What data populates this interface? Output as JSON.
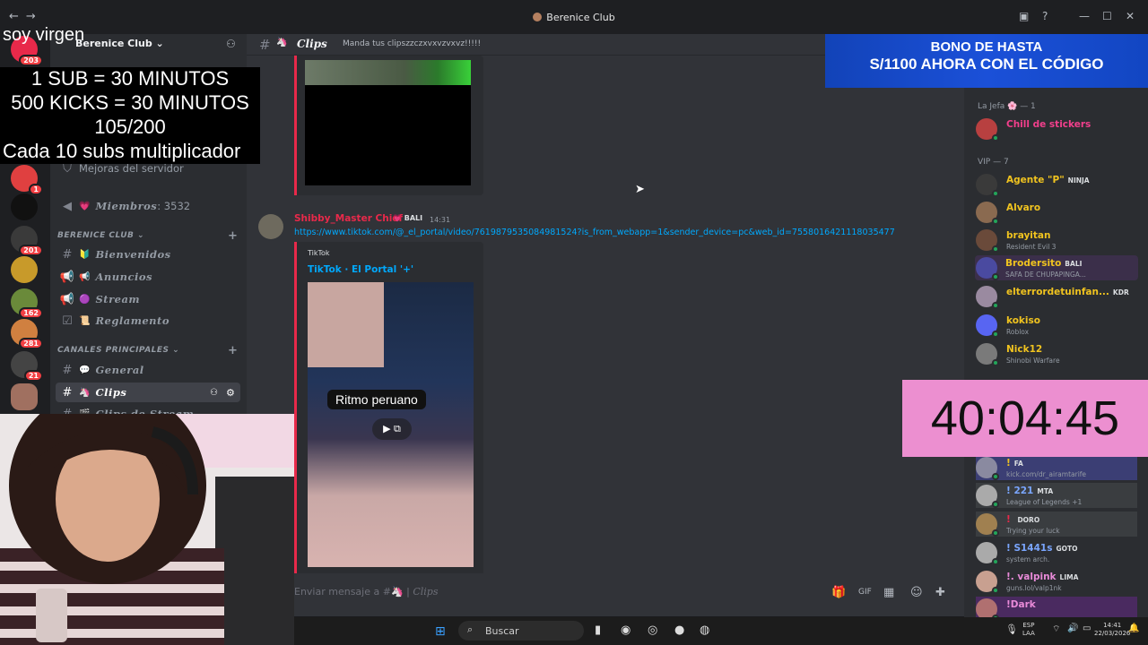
{
  "window": {
    "title": "Berenice Club"
  },
  "overlay": {
    "virgen": "soy virgen",
    "line1": "1 SUB     = 30 MINUTOS",
    "line2": "500 KICKS = 30 MINUTOS",
    "line3": "105/200",
    "line4": "Cada 10 subs multiplicador"
  },
  "rail": {
    "badges": [
      "203",
      "1",
      "201",
      "162",
      "281",
      "21"
    ]
  },
  "server": {
    "name": "Berenice Club"
  },
  "sidebar": {
    "boost": "Mejoras del servidor",
    "members_label": "Miembros",
    "members_count": ": 3532",
    "cat1": "BERENICE CLUB",
    "cat2": "CANALES PRINCIPALES",
    "channels": [
      "Bienvenidos",
      "Anuncios",
      "Stream",
      "Reglamento",
      "General",
      "Clips",
      "Clips de Stream"
    ]
  },
  "header": {
    "channel": "Clips",
    "topic": "Manda tus clipszzczxvxvzvxvz!!!!!"
  },
  "message": {
    "author": "Shibby_Master Chief",
    "tag": "BALI",
    "time": "14:31",
    "link": "https://www.tiktok.com/@_el_portal/video/7619879535084981524?is_from_webapp=1&sender_device=pc&web_id=7558016421118035477",
    "provider": "TikTok",
    "embed_title": "TikTok · El Portal '+'",
    "video_caption": "Ritmo peruano"
  },
  "composer": {
    "placeholder": "Enviar mensaje a #",
    "channel": "Clips"
  },
  "members": {
    "cat_jefa": "La Jefa 🌸 — 1",
    "cat_vip": "VIP — 7",
    "list": [
      {
        "name": "Chill de stickers",
        "sub": "",
        "tag": "",
        "color": "#f23f8c"
      },
      {
        "name": "Agente \"P\"",
        "sub": "",
        "tag": "NINJA",
        "color": "#f0c31f"
      },
      {
        "name": "Alvaro",
        "sub": "",
        "tag": "",
        "color": "#f0c31f"
      },
      {
        "name": "brayitan",
        "sub": "Resident Evil 3",
        "tag": "",
        "color": "#f0c31f"
      },
      {
        "name": "Brodersito",
        "sub": "SAFA DE CHUPAPINGA...",
        "tag": "BALI",
        "color": "#f0c31f"
      },
      {
        "name": "elterrordetuinfan...",
        "sub": "",
        "tag": "KDR",
        "color": "#f0c31f"
      },
      {
        "name": "kokiso",
        "sub": "Roblox",
        "tag": "",
        "color": "#f0c31f"
      },
      {
        "name": "Nick12",
        "sub": "Shinobi Warfare",
        "tag": "",
        "color": "#f0c31f"
      },
      {
        "name": "!",
        "sub": "kick.com/dr_airamtarife",
        "tag": "FA",
        "color": "#f0c31f"
      },
      {
        "name": "! 221",
        "sub": "League of Legends +1",
        "tag": "MTA",
        "color": "#7aa6ff"
      },
      {
        "name": "! ",
        "sub": "Trying your luck",
        "tag": "DORO",
        "color": "#e8294a"
      },
      {
        "name": "! S1441s",
        "sub": "system arch.",
        "tag": "GOTO",
        "color": "#7aa6ff"
      },
      {
        "name": "!. valpink",
        "sub": "guns.lol/valp1nk",
        "tag": "LIMA",
        "color": "#e88ad8"
      },
      {
        "name": "!Dark",
        "sub": "",
        "tag": "",
        "color": "#e88ad8"
      }
    ]
  },
  "ad": {
    "line1": "BONO DE HASTA",
    "line2": "S/1100 AHORA CON EL CÓDIGO"
  },
  "timer": {
    "value": "40:04:45"
  },
  "taskbar": {
    "search": "Buscar",
    "lang1": "ESP",
    "lang2": "LAA",
    "time": "14:41",
    "date": "22/03/2026"
  },
  "colors": {
    "accent": "#e8294a",
    "link": "#00a8fc",
    "vip": "#f0c31f",
    "timer_bg": "#ec8fd0",
    "ad_bg": "#1b50d8"
  }
}
